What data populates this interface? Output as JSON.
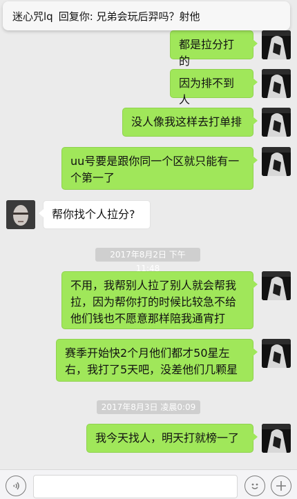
{
  "notification": {
    "sender": "迷心咒lq",
    "text": "回复你: 兄弟会玩后羿吗？射他"
  },
  "messages": [
    {
      "side": "me",
      "text": "都是拉分打的"
    },
    {
      "side": "me",
      "text": "因为排不到人"
    },
    {
      "side": "me",
      "text": "没人像我这样去打单排"
    },
    {
      "side": "me",
      "text": "uu号要是跟你同一个区就只能有一个第一了"
    },
    {
      "side": "other",
      "text": "帮你找个人拉分?"
    },
    {
      "side": "me",
      "text": "不用，我帮别人拉了别人就会帮我拉，因为帮你打的时候比较急不给他们钱也不愿意那样陪我通宵打"
    },
    {
      "side": "me",
      "text": "赛季开始快2个月他们都才50星左右，我打了5天吧，没差他们几颗星"
    },
    {
      "side": "me",
      "text": "我今天找人，明天打就榜一了"
    }
  ],
  "timestamps": [
    "2017年8月2日 下午11:48",
    "2017年8月3日 凌晨0:09"
  ],
  "bottom_bar": {
    "voice_icon": "voice-icon",
    "emoji_icon": "emoji-icon",
    "plus_icon": "plus-icon"
  },
  "colors": {
    "background": "#ebebeb",
    "my_bubble": "#a0e75a",
    "other_bubble": "#ffffff"
  }
}
